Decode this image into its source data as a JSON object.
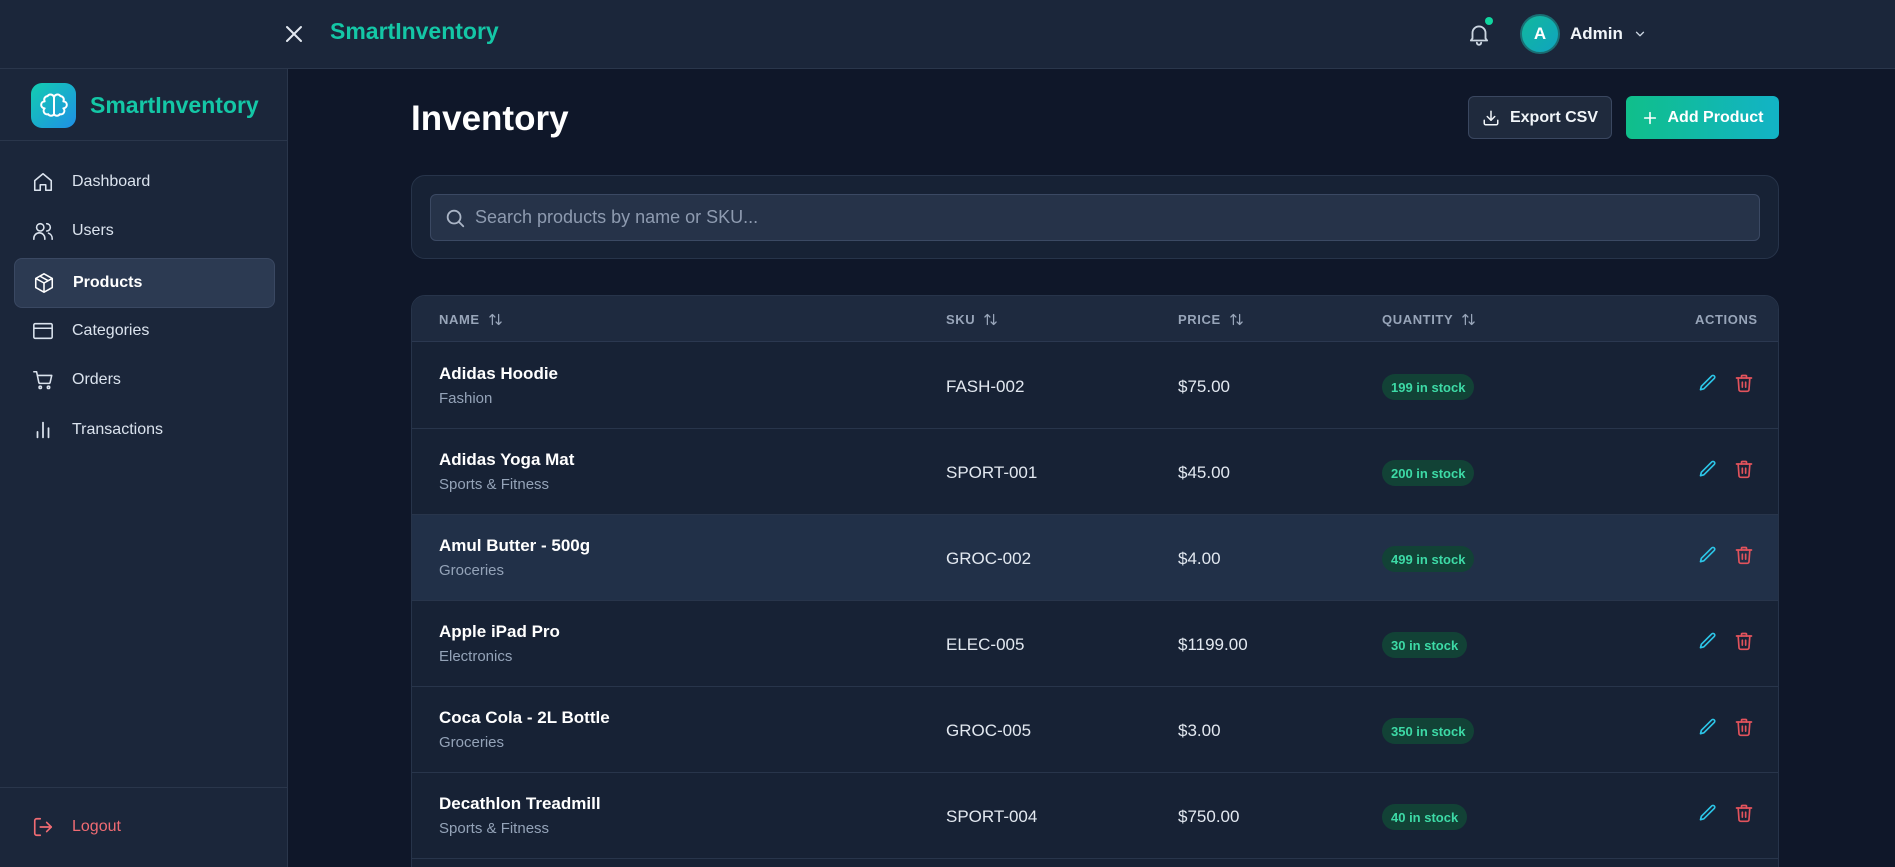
{
  "topbar": {
    "brand": "SmartInventory",
    "user_initial": "A",
    "user_name": "Admin"
  },
  "sidebar": {
    "brand": "SmartInventory",
    "items": [
      {
        "label": "Dashboard",
        "icon": "home-icon",
        "active": false
      },
      {
        "label": "Users",
        "icon": "users-icon",
        "active": false
      },
      {
        "label": "Products",
        "icon": "box-icon",
        "active": true
      },
      {
        "label": "Categories",
        "icon": "folder-icon",
        "active": false
      },
      {
        "label": "Orders",
        "icon": "cart-icon",
        "active": false
      },
      {
        "label": "Transactions",
        "icon": "bar-chart-icon",
        "active": false
      }
    ],
    "logout_label": "Logout"
  },
  "main": {
    "title": "Inventory",
    "export_label": "Export CSV",
    "add_label": "Add Product",
    "search_placeholder": "Search products by name or SKU...",
    "columns": {
      "name": "NAME",
      "sku": "SKU",
      "price": "PRICE",
      "quantity": "QUANTITY",
      "actions": "ACTIONS"
    },
    "rows": [
      {
        "name": "Adidas Hoodie",
        "category": "Fashion",
        "sku": "FASH-002",
        "price": "$75.00",
        "stock": "199 in stock"
      },
      {
        "name": "Adidas Yoga Mat",
        "category": "Sports & Fitness",
        "sku": "SPORT-001",
        "price": "$45.00",
        "stock": "200 in stock"
      },
      {
        "name": "Amul Butter - 500g",
        "category": "Groceries",
        "sku": "GROC-002",
        "price": "$4.00",
        "stock": "499 in stock"
      },
      {
        "name": "Apple iPad Pro",
        "category": "Electronics",
        "sku": "ELEC-005",
        "price": "$1199.00",
        "stock": "30 in stock"
      },
      {
        "name": "Coca Cola - 2L Bottle",
        "category": "Groceries",
        "sku": "GROC-005",
        "price": "$3.00",
        "stock": "350 in stock"
      },
      {
        "name": "Decathlon Treadmill",
        "category": "Sports & Fitness",
        "sku": "SPORT-004",
        "price": "$750.00",
        "stock": "40 in stock"
      }
    ]
  },
  "colors": {
    "accent": "#14c7a6",
    "background": "#0f1729",
    "panel": "#1b263a",
    "stock_badge_bg": "#124236",
    "stock_badge_text": "#3ddaa6",
    "edit_icon": "#2cc6e8",
    "delete_icon": "#e2535c"
  }
}
